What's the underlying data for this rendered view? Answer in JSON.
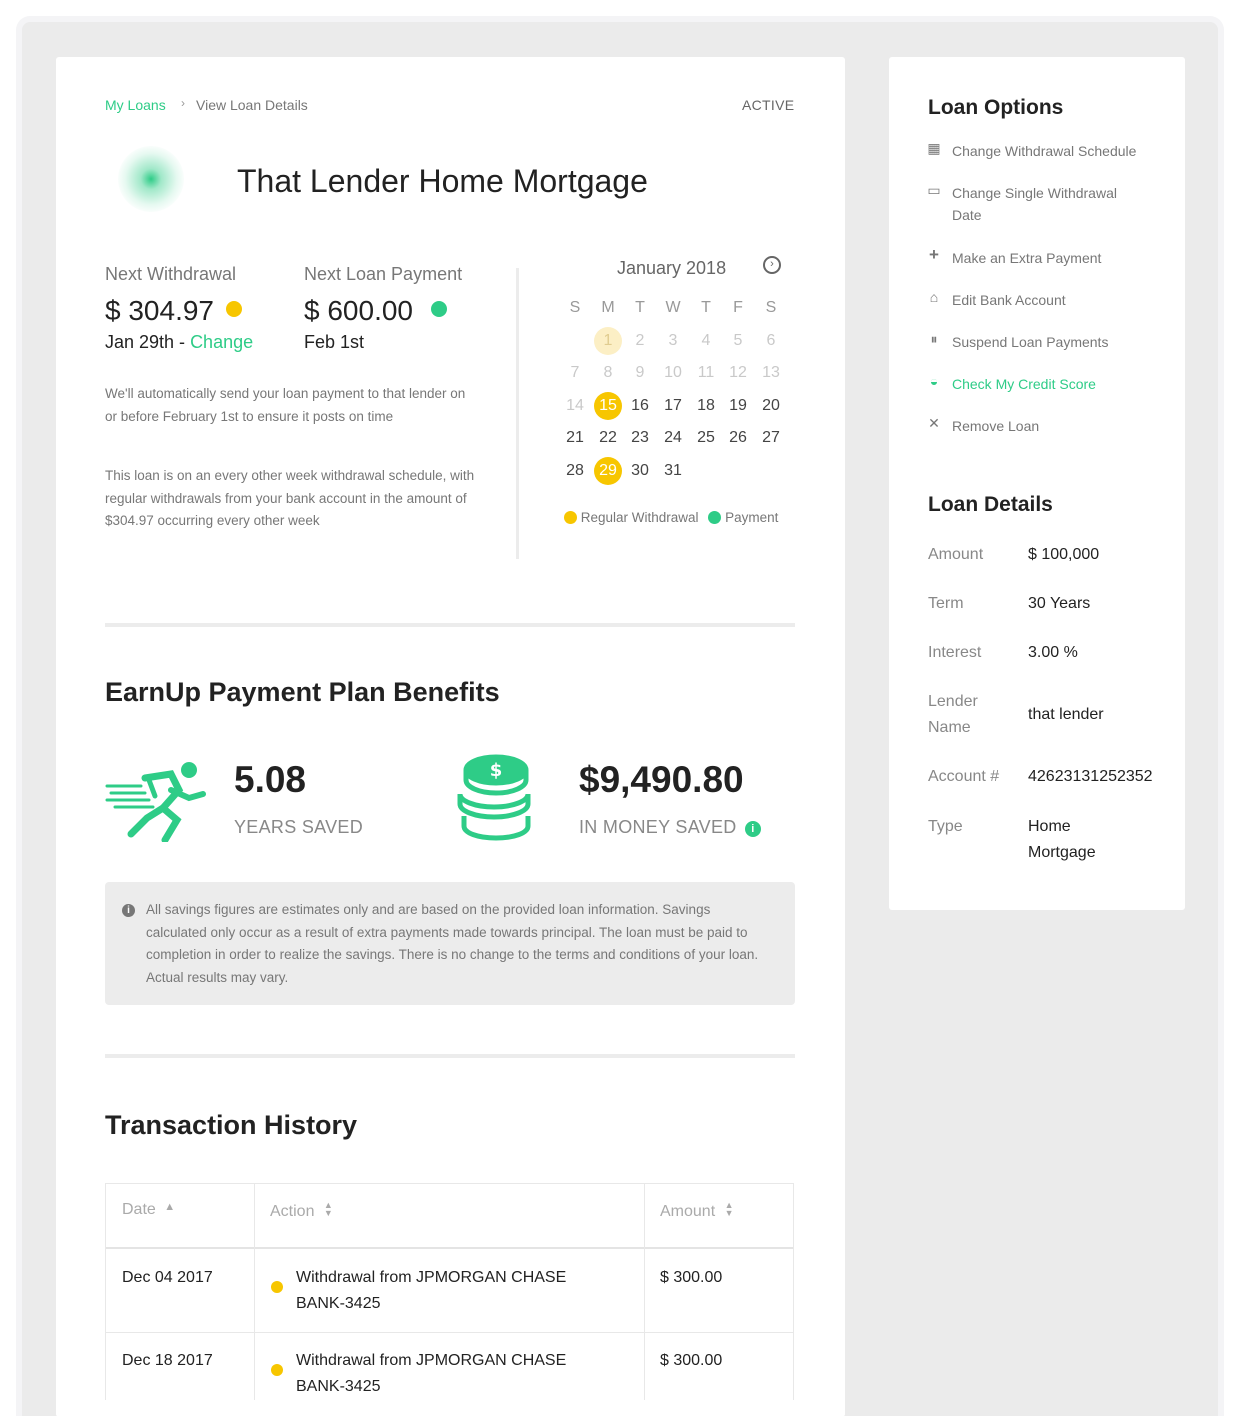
{
  "breadcrumb": {
    "link": "My Loans",
    "separator": "›",
    "current": "View Loan Details"
  },
  "status": "ACTIVE",
  "loan_title": "That Lender Home Mortgage",
  "next_withdrawal": {
    "label": "Next Withdrawal",
    "amount": "$ 304.97",
    "date": "Jan 29th - ",
    "change": "Change"
  },
  "next_payment": {
    "label": "Next Loan Payment",
    "amount": "$ 600.00",
    "date": "Feb 1st"
  },
  "paragraphs": [
    "We'll automatically send your loan payment to that lender on or before February 1st to ensure it posts on time",
    "This loan is on an every other week withdrawal schedule, with regular withdrawals from your bank account in the amount of $304.97 occurring every other week"
  ],
  "calendar": {
    "month": "January 2018",
    "weekdays": [
      "S",
      "M",
      "T",
      "W",
      "T",
      "F",
      "S"
    ],
    "legend_withdrawal": "Regular Withdrawal",
    "legend_payment": "Payment"
  },
  "benefits": {
    "title": "EarnUp Payment Plan Benefits",
    "years_value": "5.08",
    "years_label": "YEARS SAVED",
    "money_value": "$9,490.80",
    "money_label": "IN MONEY SAVED",
    "note": "All savings figures are estimates only and are based on the provided loan information. Savings calculated only occur as a result of extra payments made towards principal. The loan must be paid to completion in order to realize the savings. There is no change to the terms and conditions of your loan. Actual results may vary."
  },
  "transactions": {
    "title": "Transaction History",
    "headers": [
      "Date",
      "Action",
      "Amount"
    ],
    "rows": [
      {
        "date": "Dec 04 2017",
        "action": "Withdrawal from JPMORGAN CHASE BANK-3425",
        "amount": "$ 300.00"
      },
      {
        "date": "Dec 18 2017",
        "action": "Withdrawal from JPMORGAN CHASE BANK-3425",
        "amount": "$ 300.00"
      }
    ]
  },
  "loan_options": {
    "title": "Loan Options",
    "items": [
      {
        "label": "Change Withdrawal Schedule",
        "icon": "calendar-icon"
      },
      {
        "label": "Change Single Withdrawal Date",
        "icon": "calendar-single-icon"
      },
      {
        "label": "Make an Extra Payment",
        "icon": "plus-icon"
      },
      {
        "label": "Edit Bank Account",
        "icon": "bank-icon"
      },
      {
        "label": "Suspend Loan Payments",
        "icon": "pause-icon"
      },
      {
        "label": "Check My Credit Score",
        "icon": "gauge-icon"
      },
      {
        "label": "Remove Loan",
        "icon": "close-icon"
      }
    ]
  },
  "loan_details": {
    "title": "Loan Details",
    "rows": [
      {
        "label": "Amount",
        "value": "$ 100,000"
      },
      {
        "label": "Term",
        "value": "30 Years"
      },
      {
        "label": "Interest",
        "value": "3.00 %"
      },
      {
        "label": "Lender Name",
        "value": "that lender"
      },
      {
        "label": "Account #",
        "value": "42623131252352"
      },
      {
        "label": "Type",
        "value": "Home Mortgage"
      }
    ]
  },
  "colors": {
    "accent": "#2ecc87",
    "withdrawal": "#f7c600"
  }
}
